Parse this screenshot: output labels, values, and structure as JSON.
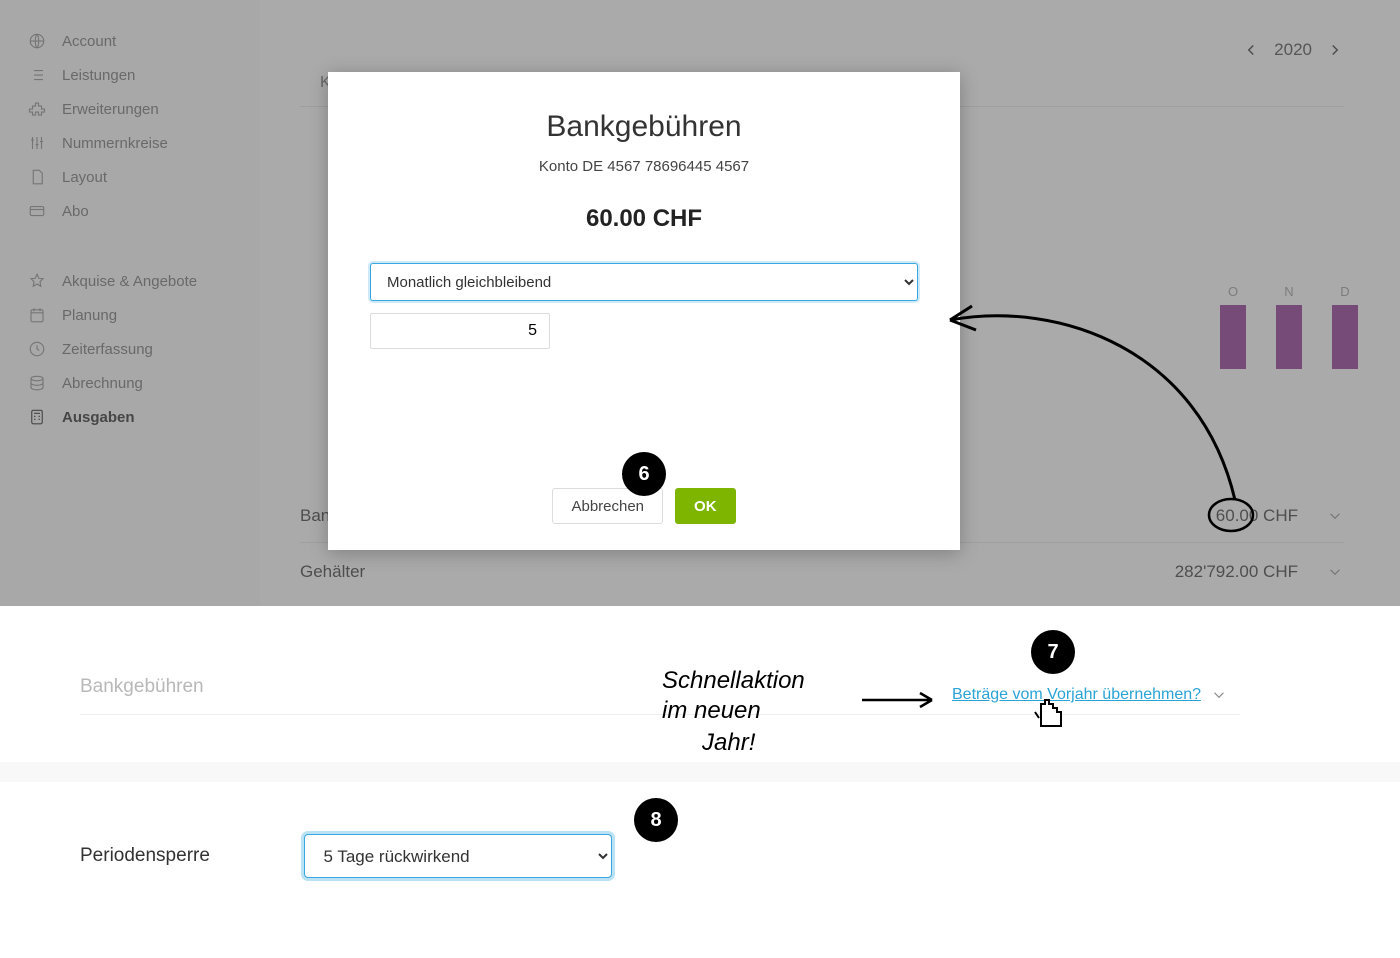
{
  "sidebar": {
    "group1": [
      {
        "icon": "globe",
        "label": "Account"
      },
      {
        "icon": "list",
        "label": "Leistungen"
      },
      {
        "icon": "puzzle",
        "label": "Erweiterungen"
      },
      {
        "icon": "sliders",
        "label": "Nummernkreise"
      },
      {
        "icon": "file",
        "label": "Layout"
      },
      {
        "icon": "card",
        "label": "Abo"
      }
    ],
    "group2": [
      {
        "icon": "star",
        "label": "Akquise & Angebote"
      },
      {
        "icon": "calendar",
        "label": "Planung"
      },
      {
        "icon": "clock",
        "label": "Zeiterfassung"
      },
      {
        "icon": "db",
        "label": "Abrechnung"
      },
      {
        "icon": "calc",
        "label": "Ausgaben",
        "active": true
      }
    ]
  },
  "header": {
    "year": "2020",
    "tab_stub": "K"
  },
  "chart": {
    "months": [
      "O",
      "N",
      "D"
    ]
  },
  "rows": [
    {
      "name": "Ban",
      "amount": "60.00 CHF"
    },
    {
      "name": "Gehälter",
      "amount": "282'792.00 CHF"
    }
  ],
  "modal": {
    "title": "Bankgebühren",
    "subtitle": "Konto DE 4567 78696445 4567",
    "total": "60.00 CHF",
    "frequency": "Monatlich gleichbleibend",
    "value": "5",
    "cancel": "Abbrechen",
    "ok": "OK"
  },
  "badges": {
    "b6": "6",
    "b7": "7",
    "b8": "8"
  },
  "section1": {
    "title": "Bankgebühren",
    "link": "Beträge vom Vorjahr übernehmen?"
  },
  "section2": {
    "label": "Periodensperre",
    "value": "5 Tage rückwirkend"
  },
  "annotations": {
    "handwriting": "Schnellaktion im neuen Jahr!"
  }
}
